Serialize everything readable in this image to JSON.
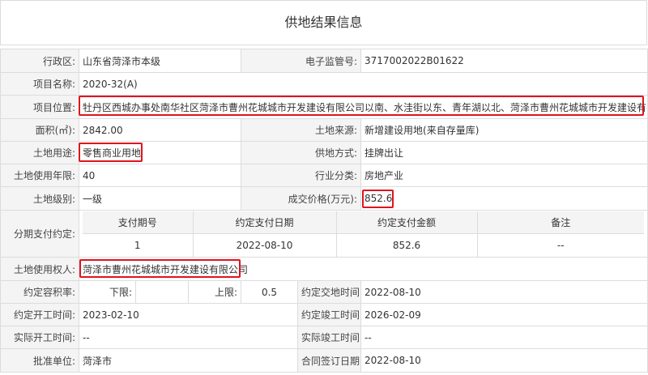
{
  "page_title": "供地结果信息",
  "rows": {
    "district": {
      "label": "行政区:",
      "value": "山东省菏泽市本级"
    },
    "supervision_no": {
      "label": "电子监管号:",
      "value": "3717002022B01622"
    },
    "project_name": {
      "label": "项目名称:",
      "value": "2020-32(A)"
    },
    "project_location": {
      "label": "项目位置:",
      "value": "牡丹区西城办事处南华社区菏泽市曹州花城城市开发建设有限公司以南、水洼街以东、青年湖以北、菏泽市曹州花城城市开发建设有限公司以西"
    },
    "area": {
      "label": "面积(㎡):",
      "value": "2842.00"
    },
    "land_source": {
      "label": "土地来源:",
      "value": "新增建设用地(来自存量库)"
    },
    "land_use": {
      "label": "土地用途:",
      "value": "零售商业用地"
    },
    "supply_method": {
      "label": "供地方式:",
      "value": "挂牌出让"
    },
    "use_years": {
      "label": "土地使用年限:",
      "value": "40"
    },
    "industry": {
      "label": "行业分类:",
      "value": "房地产业"
    },
    "land_grade": {
      "label": "土地级别:",
      "value": "一级"
    },
    "deal_price": {
      "label": "成交价格(万元):",
      "value": "852.6"
    },
    "installments": {
      "label": "分期支付约定:",
      "headers": [
        "支付期号",
        "约定支付日期",
        "约定支付金额",
        "备注"
      ],
      "rows": [
        [
          "1",
          "2022-08-10",
          "852.6",
          "--"
        ]
      ]
    },
    "land_user": {
      "label": "土地使用权人:",
      "value": "菏泽市曹州花城城市开发建设有限公司"
    },
    "plot_ratio": {
      "label": "约定容积率:",
      "lower_label": "下限:",
      "lower_value": "",
      "upper_label": "上限:",
      "upper_value": "0.5"
    },
    "handover_date": {
      "label": "约定交地时间:",
      "value": "2022-08-10"
    },
    "start_date": {
      "label": "约定开工时间:",
      "value": "2023-02-10"
    },
    "completion_date": {
      "label": "约定竣工时间:",
      "value": "2026-02-09"
    },
    "actual_start": {
      "label": "实际开工时间:",
      "value": "--"
    },
    "actual_completion": {
      "label": "实际竣工时间:",
      "value": "--"
    },
    "approval_unit": {
      "label": "批准单位:",
      "value": "菏泽市"
    },
    "contract_date": {
      "label": "合同签订日期:",
      "value": "2022-08-10"
    }
  },
  "colors": {
    "highlight_border": "#e0141e",
    "label_bg": "#f4f4f4",
    "grid_line": "#dcdcdc"
  }
}
